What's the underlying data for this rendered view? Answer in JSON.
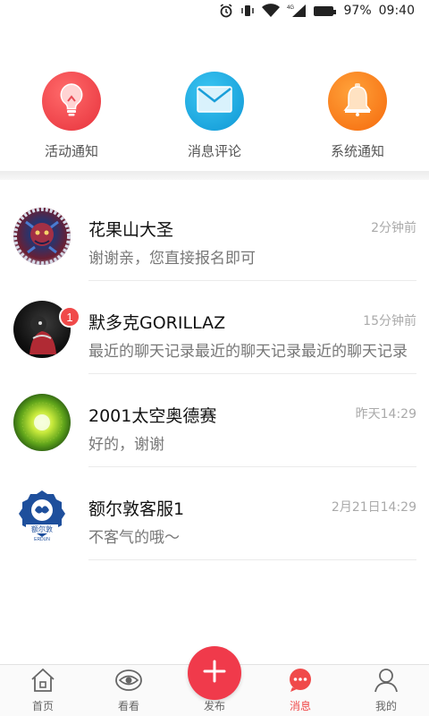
{
  "status_bar": {
    "battery": "97%",
    "time": "09:40",
    "network": "4G"
  },
  "notifications": [
    {
      "label": "活动通知",
      "icon": "bulb-icon",
      "color": "#f0434e"
    },
    {
      "label": "消息评论",
      "icon": "envelope-icon",
      "color": "#1ea9e0"
    },
    {
      "label": "系统通知",
      "icon": "bell-icon",
      "color": "#f97d12"
    }
  ],
  "conversations": [
    {
      "name": "花果山大圣",
      "time": "2分钟前",
      "preview": "谢谢亲，您直接报名即可",
      "badge": ""
    },
    {
      "name": "默多克GORILLAZ",
      "time": "15分钟前",
      "preview": "最近的聊天记录最近的聊天记录最近的聊天记录",
      "badge": "1"
    },
    {
      "name": "2001太空奥德赛",
      "time": "昨天14:29",
      "preview": "好的，谢谢",
      "badge": ""
    },
    {
      "name": "额尔敦客服1",
      "time": "2月21日14:29",
      "preview": "不客气的哦～",
      "badge": ""
    }
  ],
  "avatar_logo": {
    "line1": "额尔敦",
    "line2": "ERDUN"
  },
  "bottom_nav": {
    "home": "首页",
    "watch": "看看",
    "publish": "发布",
    "messages": "消息",
    "mine": "我的"
  },
  "colors": {
    "accent": "#f04a4a",
    "publish": "#f03a4b"
  }
}
